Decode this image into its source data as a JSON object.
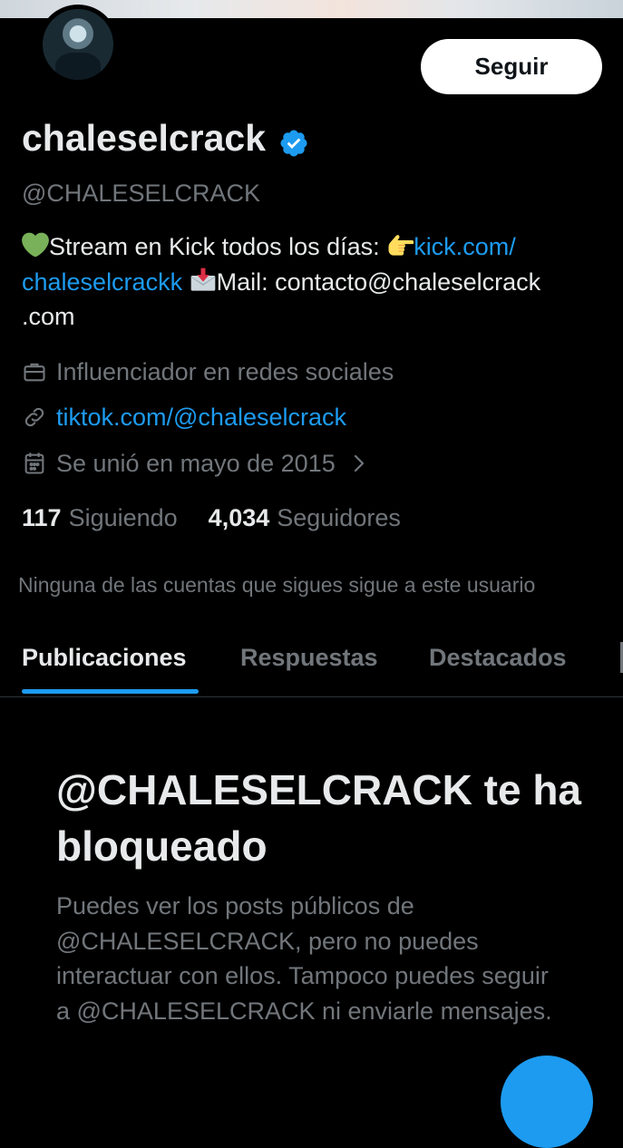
{
  "profile": {
    "display_name": "chaleselcrack",
    "handle": "@CHALESELCRACK",
    "follow_label": "Seguir",
    "bio": {
      "part1": "Stream en Kick todos los días: ",
      "link1": "kick.com/",
      "link2": "chaleselcrackk",
      "part2": "Mail: contacto@chaleselcrack",
      "part3": ".com"
    },
    "category": "Influenciador en redes sociales",
    "website": "tiktok.com/@chaleselcrack",
    "joined": "Se unió en mayo de 2015",
    "following_count": "117",
    "following_label": "Siguiendo",
    "followers_count": "4,034",
    "followers_label": "Seguidores",
    "followers_note": "Ninguna de las cuentas que sigues sigue a este usuario"
  },
  "tabs": [
    {
      "label": "Publicaciones",
      "active": true
    },
    {
      "label": "Respuestas",
      "active": false
    },
    {
      "label": "Destacados",
      "active": false
    }
  ],
  "blocked": {
    "title": "@CHALESELCRACK te ha bloqueado",
    "description": "Puedes ver los posts públicos de @CHALESELCRACK, pero no puedes interactuar con ellos. Tampoco puedes seguir a @CHALESELCRACK ni enviarle mensajes."
  },
  "icons": {
    "verified": "verified-badge-icon",
    "green_heart": "green-heart-emoji",
    "pointing_hand": "backhand-index-pointing-right-emoji",
    "envelope": "envelope-with-arrow-emoji",
    "category": "briefcase-icon",
    "website": "link-icon",
    "joined": "calendar-icon",
    "chevron": "chevron-right-icon"
  },
  "colors": {
    "background": "#000000",
    "primary_text": "#e7e9ea",
    "secondary_text": "#71767b",
    "link": "#1d9bf0",
    "accent": "#1d9bf0",
    "follow_button_bg": "#ffffff"
  }
}
